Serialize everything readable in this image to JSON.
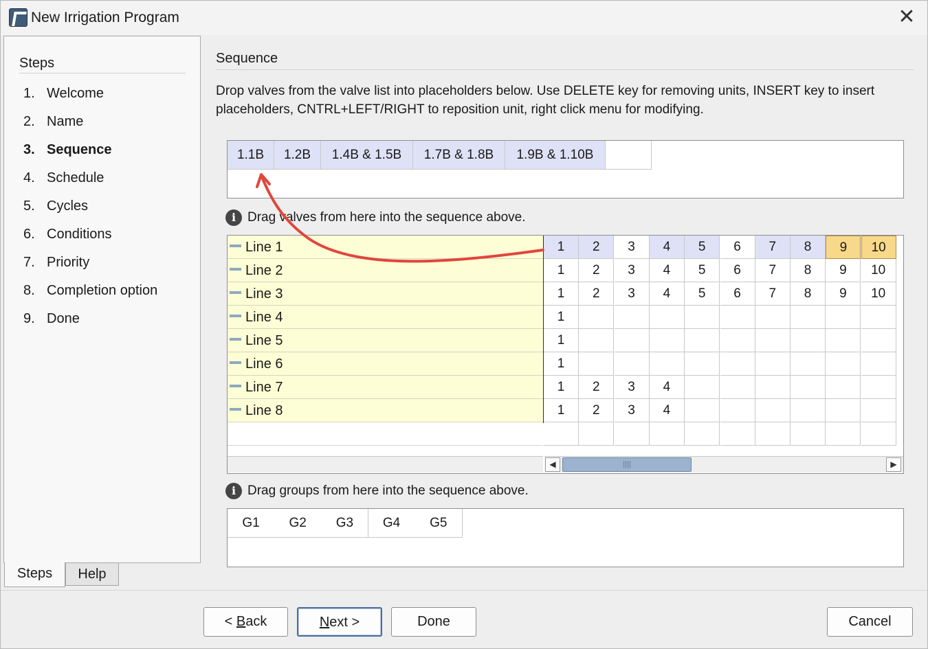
{
  "window": {
    "title": "New Irrigation Program",
    "close_label": "✕"
  },
  "steps": {
    "header": "Steps",
    "items": [
      {
        "num": "1.",
        "label": "Welcome"
      },
      {
        "num": "2.",
        "label": "Name"
      },
      {
        "num": "3.",
        "label": "Sequence"
      },
      {
        "num": "4.",
        "label": "Schedule"
      },
      {
        "num": "5.",
        "label": "Cycles"
      },
      {
        "num": "6.",
        "label": "Conditions"
      },
      {
        "num": "7.",
        "label": "Priority"
      },
      {
        "num": "8.",
        "label": "Completion option"
      },
      {
        "num": "9.",
        "label": "Done"
      }
    ],
    "active_index": 2
  },
  "tabs": {
    "steps": "Steps",
    "help": "Help"
  },
  "main": {
    "section_title": "Sequence",
    "instructions": "Drop valves from the valve list into placeholders below. Use DELETE key for removing units, INSERT key to insert placeholders, CNTRL+LEFT/RIGHT to reposition unit, right click menu for modifying.",
    "sequence": [
      "1.1B",
      "1.2B",
      "1.4B & 1.5B",
      "1.7B & 1.8B",
      "1.9B & 1.10B",
      ""
    ],
    "valves_hint": "Drag valves from here into the sequence above.",
    "groups_hint": "Drag groups from here into the sequence above."
  },
  "valve_grid": {
    "rows": [
      {
        "line": "Line 1",
        "valves": [
          "1",
          "2",
          "3",
          "4",
          "5",
          "6",
          "7",
          "8",
          "9",
          "10"
        ],
        "selected": [
          0,
          1,
          3,
          4,
          6,
          7
        ],
        "highlighted": [
          8,
          9
        ]
      },
      {
        "line": "Line 2",
        "valves": [
          "1",
          "2",
          "3",
          "4",
          "5",
          "6",
          "7",
          "8",
          "9",
          "10"
        ],
        "selected": [],
        "highlighted": []
      },
      {
        "line": "Line 3",
        "valves": [
          "1",
          "2",
          "3",
          "4",
          "5",
          "6",
          "7",
          "8",
          "9",
          "10"
        ],
        "selected": [],
        "highlighted": []
      },
      {
        "line": "Line 4",
        "valves": [
          "1"
        ],
        "selected": [],
        "highlighted": []
      },
      {
        "line": "Line 5",
        "valves": [
          "1"
        ],
        "selected": [],
        "highlighted": []
      },
      {
        "line": "Line 6",
        "valves": [
          "1"
        ],
        "selected": [],
        "highlighted": []
      },
      {
        "line": "Line 7",
        "valves": [
          "1",
          "2",
          "3",
          "4"
        ],
        "selected": [],
        "highlighted": []
      },
      {
        "line": "Line 8",
        "valves": [
          "1",
          "2",
          "3",
          "4"
        ],
        "selected": [],
        "highlighted": []
      }
    ],
    "scroll_left": "◀",
    "scroll_right": "▶",
    "scroll_grip": "||||"
  },
  "groups": [
    "G1",
    "G2",
    "G3",
    "G4",
    "G5"
  ],
  "buttons": {
    "back_prefix": "< ",
    "back_mnemonic": "B",
    "back_rest": "ack",
    "next_mnemonic": "N",
    "next_rest": "ext >",
    "done": "Done",
    "cancel": "Cancel"
  },
  "colors": {
    "selected_cell": "#dfe2f6",
    "highlighted_cell": "#f8d98a",
    "line_row": "#fefed6",
    "arrow": "#e0463c"
  }
}
